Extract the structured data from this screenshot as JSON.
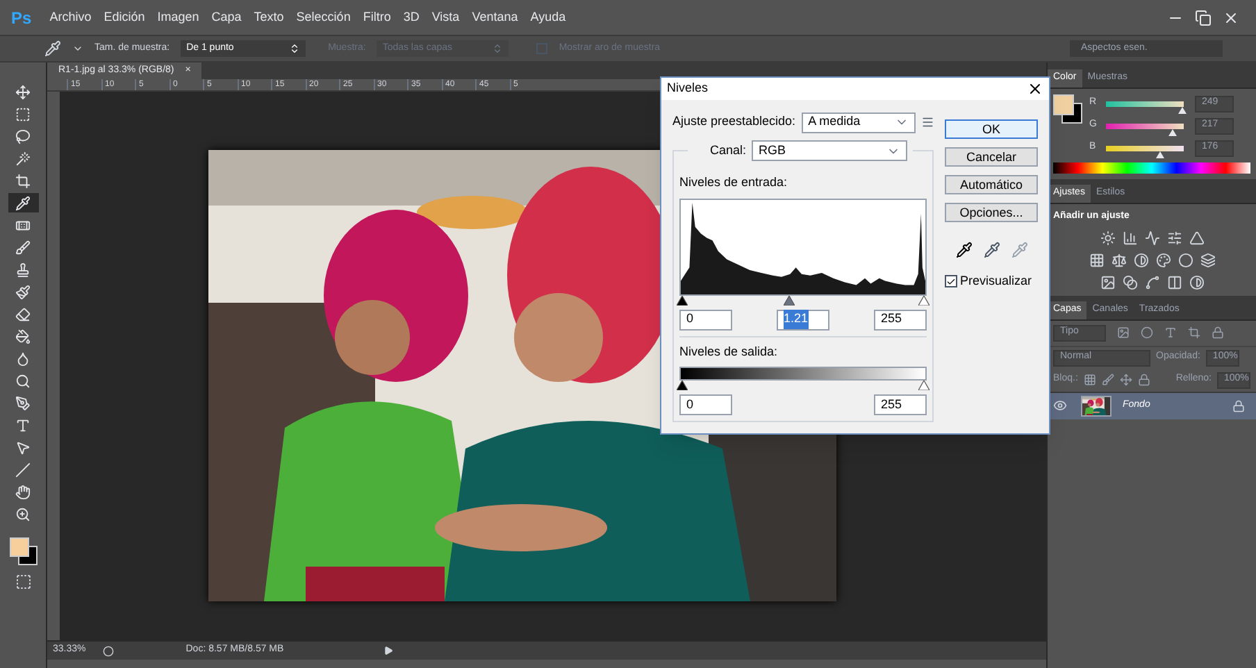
{
  "app": {
    "logo": "Ps"
  },
  "menu": [
    "Archivo",
    "Edición",
    "Imagen",
    "Capa",
    "Texto",
    "Selección",
    "Filtro",
    "3D",
    "Vista",
    "Ventana",
    "Ayuda"
  ],
  "options_bar": {
    "sample_size_label": "Tam. de muestra:",
    "sample_size": "De 1 punto",
    "sample_label": "Muestra:",
    "sample": "Todas las capas",
    "show_ring": {
      "label": "Mostrar aro de muestra",
      "checked": false
    },
    "workspace": "Aspectos esen."
  },
  "tools": [
    {
      "kind": "move",
      "selected": false
    },
    {
      "kind": "marquee",
      "selected": false
    },
    {
      "kind": "lasso",
      "selected": false
    },
    {
      "kind": "wand",
      "selected": false
    },
    {
      "kind": "crop",
      "selected": false
    },
    {
      "kind": "eyedropper",
      "selected": true
    },
    {
      "kind": "healing",
      "selected": false
    },
    {
      "kind": "brush",
      "selected": false
    },
    {
      "kind": "stamp",
      "selected": false
    },
    {
      "kind": "history",
      "selected": false
    },
    {
      "kind": "eraser",
      "selected": false
    },
    {
      "kind": "bucket",
      "selected": false
    },
    {
      "kind": "blur",
      "selected": false
    },
    {
      "kind": "dodge",
      "selected": false
    },
    {
      "kind": "pen",
      "selected": false
    },
    {
      "kind": "type",
      "selected": false
    },
    {
      "kind": "path",
      "selected": false
    },
    {
      "kind": "line",
      "selected": false
    },
    {
      "kind": "hand",
      "selected": false
    },
    {
      "kind": "zoom",
      "selected": false
    }
  ],
  "document": {
    "tab": "R1-1.jpg al 33.3% (RGB/8)",
    "tab_close": "×",
    "ruler_marks": [
      "15",
      "10",
      "5",
      "0",
      "5",
      "10",
      "15",
      "20",
      "25",
      "30",
      "35",
      "40",
      "45",
      "5"
    ]
  },
  "status_bar": {
    "zoom": "33.33%",
    "doc": "Doc: 8.57 MB/8.57 MB"
  },
  "levels_dialog": {
    "title": "Niveles",
    "preset_label": "Ajuste preestablecido:",
    "preset": "A medida",
    "channel_label": "Canal:",
    "channel": "RGB",
    "input_label": "Niveles de entrada:",
    "input_thumbs": [
      {
        "level": 0
      },
      {
        "level": 0.44
      },
      {
        "level": 1
      }
    ],
    "input_values": [
      "0",
      "1.21",
      "255"
    ],
    "output_label": "Niveles de salida:",
    "output_thumbs": [
      {
        "level": 0
      },
      {
        "level": 1
      }
    ],
    "output_values": [
      "0",
      "255"
    ],
    "buttons": [
      {
        "label": "OK",
        "selected": true
      },
      {
        "label": "Cancelar",
        "selected": false
      },
      {
        "label": "Automático",
        "selected": false
      },
      {
        "label": "Opciones...",
        "selected": false
      }
    ],
    "preview": {
      "label": "Previsualizar",
      "checked": true
    }
  },
  "color_panel": {
    "tabs": [
      {
        "label": "Color",
        "selected": true
      },
      {
        "label": "Muestras",
        "selected": false
      }
    ],
    "channels": [
      {
        "name": "R",
        "level": 0.98,
        "value": "249"
      },
      {
        "name": "G",
        "level": 0.85,
        "value": "217"
      },
      {
        "name": "B",
        "level": 0.69,
        "value": "176"
      }
    ]
  },
  "adjustments_panel": {
    "tabs": [
      {
        "label": "Ajustes",
        "selected": true
      },
      {
        "label": "Estilos",
        "selected": false
      }
    ],
    "heading": "Añadir un ajuste"
  },
  "layers_panel": {
    "tabs": [
      {
        "label": "Capas",
        "selected": true
      },
      {
        "label": "Canales",
        "selected": false
      },
      {
        "label": "Trazados",
        "selected": false
      }
    ],
    "filter": "Tipo",
    "blend_mode": "Normal",
    "opacity_label": "Opacidad:",
    "opacity": "100%",
    "lock_label": "Bloq.:",
    "fill_label": "Relleno:",
    "fill": "100%",
    "layers": [
      {
        "name": "Fondo",
        "visible": true,
        "selected": true,
        "locked": true
      }
    ]
  }
}
